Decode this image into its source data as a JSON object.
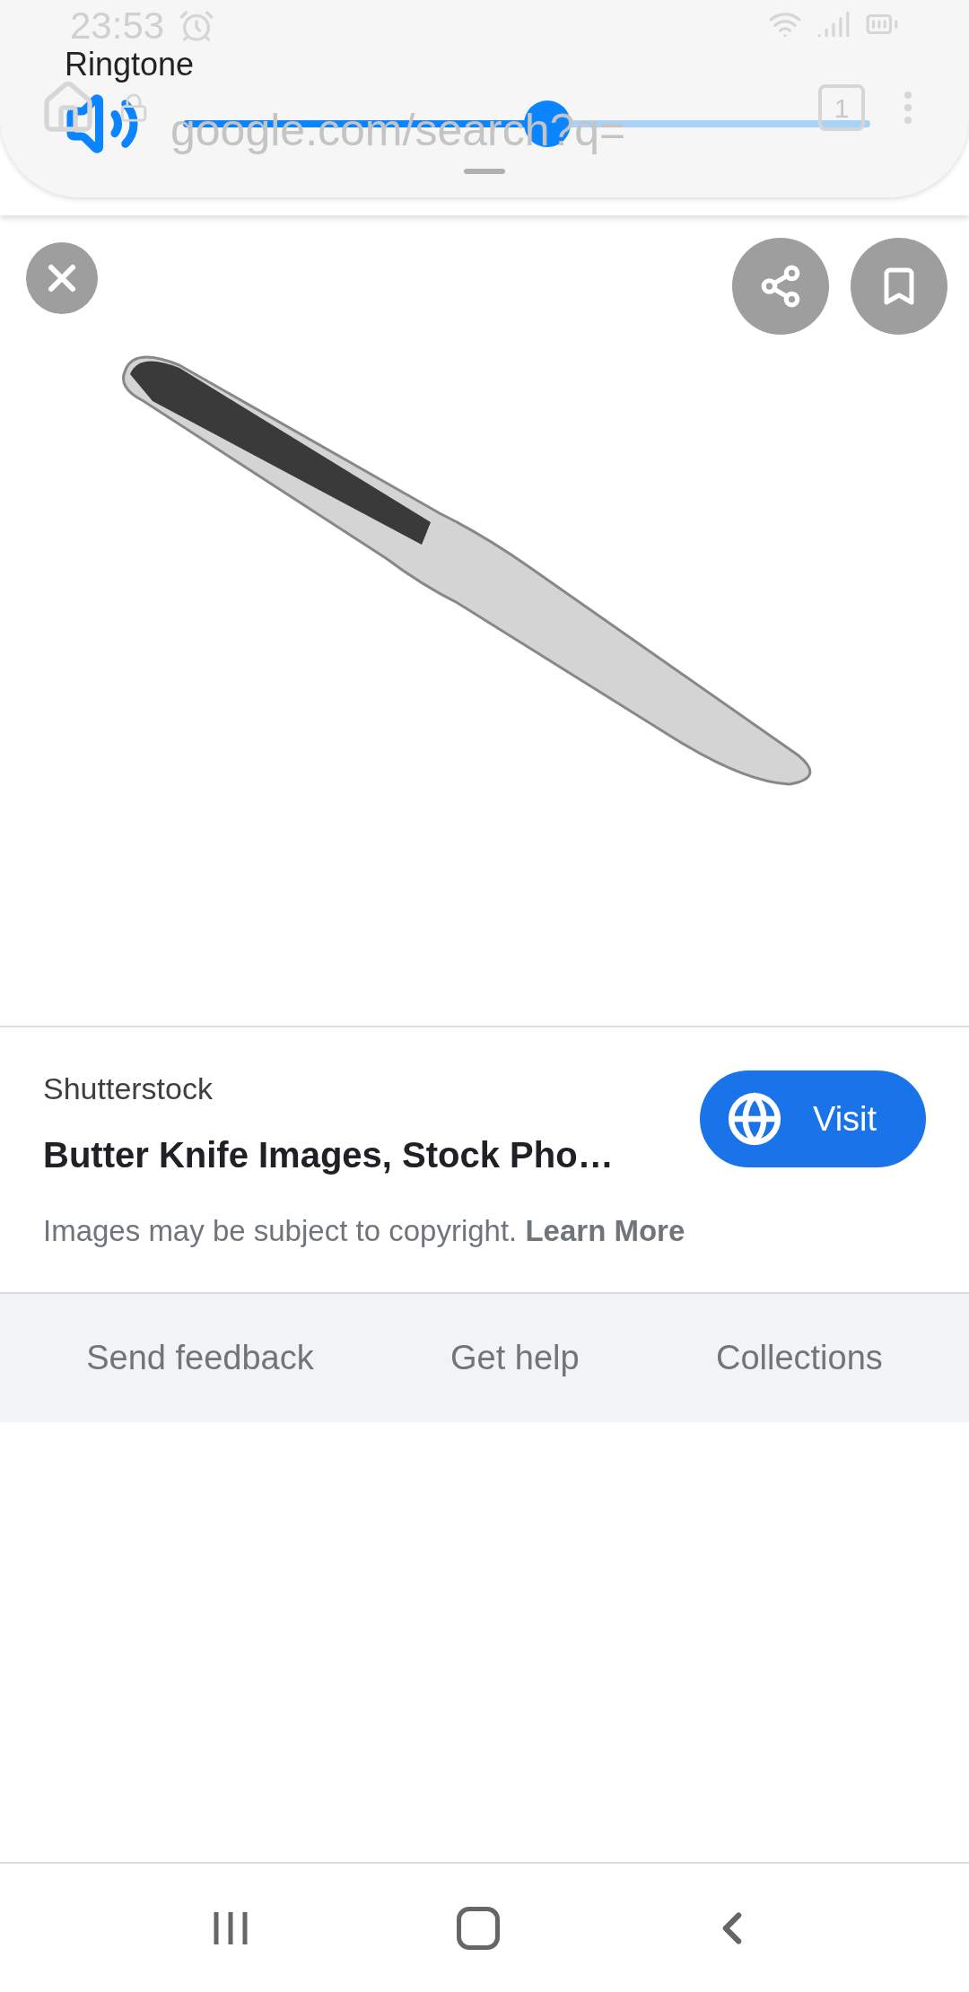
{
  "status_bar": {
    "time": "23:53"
  },
  "browser_bar": {
    "url": "google.com/search?q=",
    "tab_count": "1"
  },
  "volume_panel": {
    "title": "Ringtone",
    "level": 0.53
  },
  "result": {
    "source": "Shutterstock",
    "title": "Butter Knife Images, Stock Pho…",
    "notice": "Images may be subject to copyright.",
    "link": "Learn More",
    "visit_button": "Visit"
  },
  "footer_links": [
    "Send feedback",
    "Get help",
    "Collections"
  ]
}
